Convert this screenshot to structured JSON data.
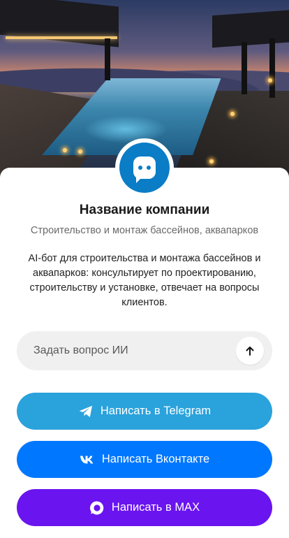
{
  "company": {
    "name": "Название компании",
    "tagline": "Строительство и монтаж бассейнов, аквапарков",
    "description": "AI-бот для строительства и монтажа бассейнов и аквапарков: консультирует по проектированию, строительству и установке, отвечает на вопросы клиентов."
  },
  "ask": {
    "placeholder": "Задать вопрос ИИ"
  },
  "buttons": {
    "telegram": "Написать в Telegram",
    "vk": "Написать Вконтакте",
    "max": "Написать в MAX"
  },
  "colors": {
    "brand": "#0a7dc6",
    "telegram": "#2aa2dc",
    "vk": "#0077ff",
    "max": "#6a14ef"
  },
  "icons": {
    "avatar": "chat-bubble-icon",
    "send": "arrow-up-icon",
    "telegram": "telegram-icon",
    "vk": "vk-icon",
    "max": "max-icon"
  }
}
